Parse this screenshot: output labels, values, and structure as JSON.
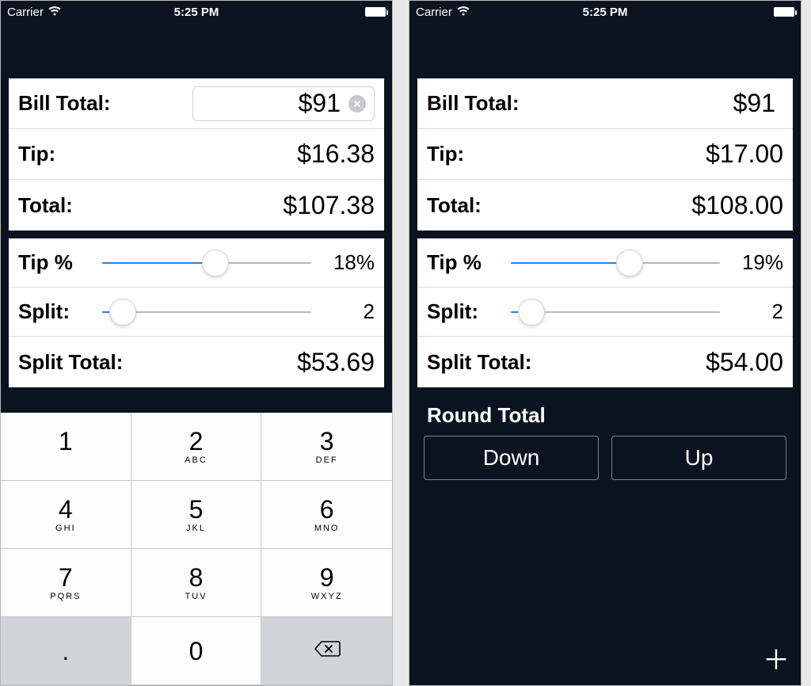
{
  "status": {
    "carrier": "Carrier",
    "time": "5:25 PM"
  },
  "phone1": {
    "bill": {
      "label": "Bill Total:",
      "value": "$91"
    },
    "tip": {
      "label": "Tip:",
      "value": "$16.38"
    },
    "total": {
      "label": "Total:",
      "value": "$107.38"
    },
    "tipPct": {
      "label": "Tip %",
      "value": "18%",
      "pos": 54
    },
    "split": {
      "label": "Split:",
      "value": "2",
      "pos": 10
    },
    "splitTotal": {
      "label": "Split Total:",
      "value": "$53.69"
    },
    "keypad": {
      "keys": [
        "1",
        "2",
        "3",
        "4",
        "5",
        "6",
        "7",
        "8",
        "9",
        ".",
        "0"
      ],
      "letters": {
        "2": "ABC",
        "3": "DEF",
        "4": "GHI",
        "5": "JKL",
        "6": "MNO",
        "7": "PQRS",
        "8": "TUV",
        "9": "WXYZ"
      }
    }
  },
  "phone2": {
    "bill": {
      "label": "Bill Total:",
      "value": "$91"
    },
    "tip": {
      "label": "Tip:",
      "value": "$17.00"
    },
    "total": {
      "label": "Total:",
      "value": "$108.00"
    },
    "tipPct": {
      "label": "Tip %",
      "value": "19%",
      "pos": 57
    },
    "split": {
      "label": "Split:",
      "value": "2",
      "pos": 10
    },
    "splitTotal": {
      "label": "Split Total:",
      "value": "$54.00"
    },
    "round": {
      "title": "Round Total",
      "down": "Down",
      "up": "Up"
    }
  }
}
